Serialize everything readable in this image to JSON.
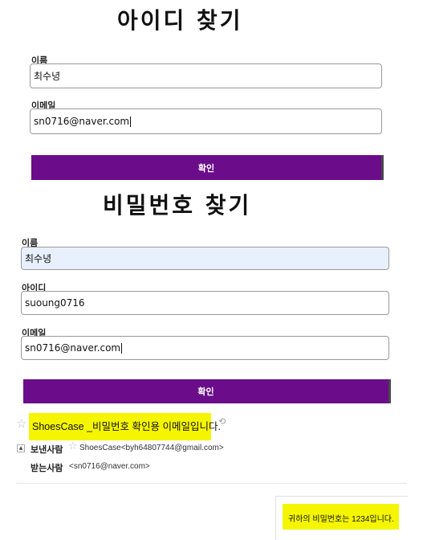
{
  "find_id": {
    "title": "아이디 찾기",
    "name_label": "이름",
    "name_value": "최수녕",
    "email_label": "이메일",
    "email_value": "sn0716@naver.com",
    "confirm_label": "확인"
  },
  "find_password": {
    "title": "비밀번호 찾기",
    "name_label": "이름",
    "name_value": "최수녕",
    "id_label": "아이디",
    "id_value": "suoung0716",
    "email_label": "이메일",
    "email_value": "sn0716@naver.com",
    "confirm_label": "확인"
  },
  "email": {
    "subject": "ShoesCase _비밀번호 확인용 이메일입니다.",
    "sender_label": "보낸사람",
    "sender_value": "ShoesCase<byh64807744@gmail.com>",
    "recipient_label": "받는사람",
    "recipient_value": "<sn0716@naver.com>",
    "body": "귀하의 비밀번호는 1234입니다.",
    "highlight_color": "#f5f500"
  },
  "colors": {
    "button": "#6b0c8a",
    "autofill": "#e8f0fe"
  }
}
